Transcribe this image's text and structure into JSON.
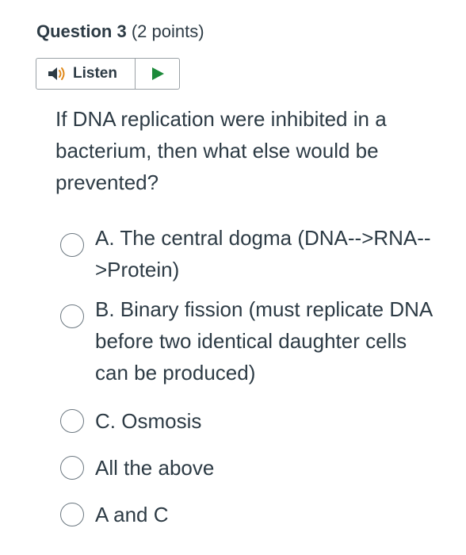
{
  "question": {
    "title": "Question 3",
    "points": "(2 points)",
    "prompt": "If DNA replication were inhibited in a bacterium, then what else would be prevented?"
  },
  "listen": {
    "label": "Listen",
    "speaker_icon": "speaker-icon",
    "play_icon": "play-icon",
    "speaker_color": "#2d3b45",
    "play_color": "#1c8a3a"
  },
  "options": [
    {
      "label": "A. The central dogma (DNA-->RNA-->Protein)"
    },
    {
      "label": "B. Binary fission (must replicate DNA before two identical daughter cells can be produced)"
    },
    {
      "label": "C. Osmosis"
    },
    {
      "label": "All the above"
    },
    {
      "label": "A and C"
    }
  ]
}
